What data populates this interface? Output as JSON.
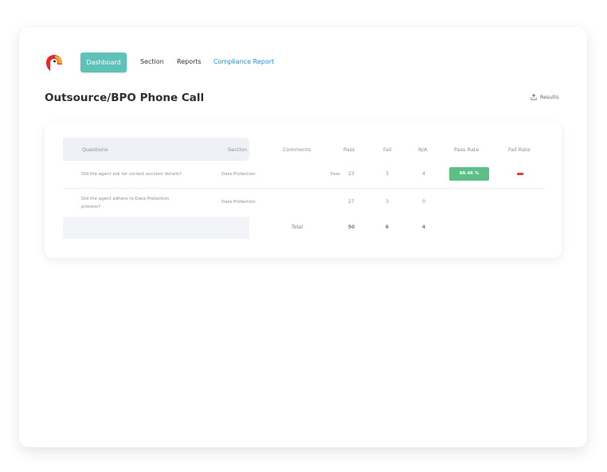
{
  "nav": {
    "dashboard_label": "Dashboard",
    "section_label": "Section",
    "reports_label": "Reports",
    "compliance_label": "Compliance Report"
  },
  "page": {
    "title": "Outsource/BPO Phone Call",
    "results_label": "Results"
  },
  "table": {
    "headers": {
      "questions": "Questions",
      "section": "Section",
      "comments": "Comments",
      "pass": "Pass",
      "fail": "Fail",
      "na": "N/A",
      "pass_rate": "Pass Rate",
      "fail_rate": "Fail Rate"
    },
    "rows": [
      {
        "question": "Did the agent ask for correct account details?",
        "section": "Data Protection",
        "comment": "Pass",
        "pass": "23",
        "fail": "3",
        "na": "4",
        "pass_rate": "88.46 %"
      },
      {
        "question": "Did the agent adhere to Data Protection process?",
        "section": "Data Protection",
        "comment": "",
        "pass": "27",
        "fail": "3",
        "na": "0",
        "pass_rate": ""
      }
    ],
    "total": {
      "label": "Total",
      "pass": "50",
      "fail": "6",
      "na": "4"
    }
  },
  "colors": {
    "accent": "#5fc2b9",
    "link_active": "#1f8fd8",
    "pass_rate": "#5cbf86",
    "fail_rate": "#e53b3b"
  }
}
